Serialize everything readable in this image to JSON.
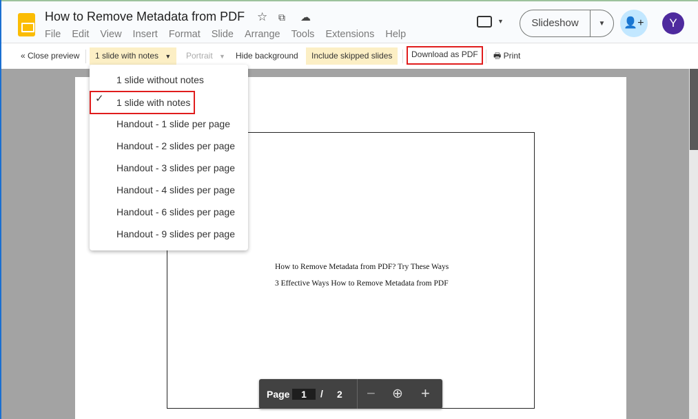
{
  "header": {
    "title": "How to Remove Metadata from PDF",
    "menu": [
      "File",
      "Edit",
      "View",
      "Insert",
      "Format",
      "Slide",
      "Arrange",
      "Tools",
      "Extensions",
      "Help"
    ],
    "slideshow_label": "Slideshow",
    "avatar_letter": "Y",
    "avatar_color": "#4e2a9e"
  },
  "toolbar": {
    "close_preview": "« Close preview",
    "layout": "1 slide with notes",
    "orientation": "Portrait",
    "hide_background": "Hide background",
    "include_skipped": "Include skipped slides",
    "download_pdf": "Download as PDF",
    "print": "Print"
  },
  "dropdown": {
    "options": [
      "1 slide without notes",
      "1 slide with notes",
      "Handout - 1 slide per page",
      "Handout - 2 slides per page",
      "Handout - 3 slides per page",
      "Handout - 4 slides per page",
      "Handout - 6 slides per page",
      "Handout - 9 slides per page"
    ],
    "selected": "1 slide with notes"
  },
  "slide": {
    "line1": "How to Remove Metadata from PDF? Try These Ways",
    "line2": "3 Effective Ways How to Remove Metadata from PDF"
  },
  "pager": {
    "label": "Page",
    "current": "1",
    "separator": "/",
    "total": "2"
  }
}
